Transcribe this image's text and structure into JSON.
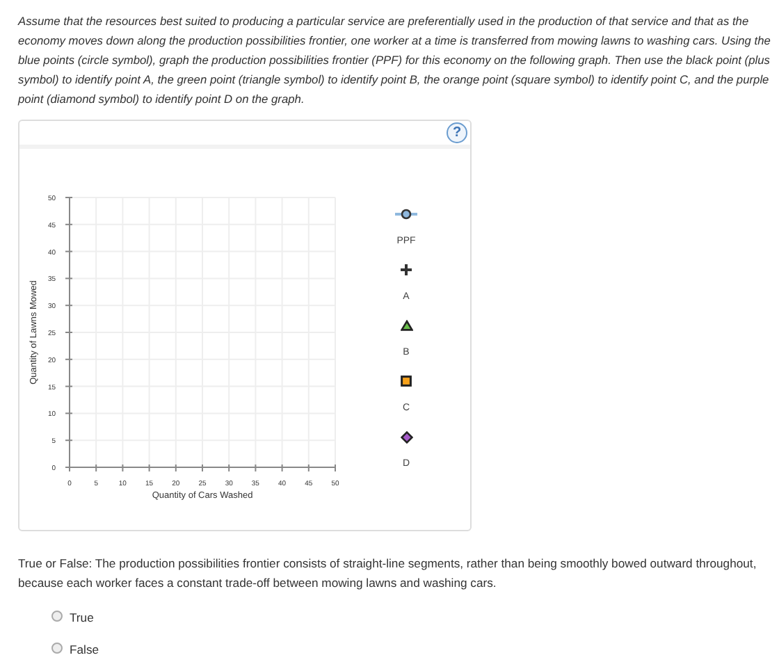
{
  "instructions": "Assume that the resources best suited to producing a particular service are preferentially used in the production of that service and that as the economy moves down along the production possibilities frontier, one worker at a time is transferred from mowing lawns to washing cars. Using the blue points (circle symbol), graph the production possibilities frontier (PPF) for this economy on the following graph. Then use the black point (plus symbol) to identify point A, the green point (triangle symbol) to identify point B, the orange point (square symbol) to identify point C, and the purple point (diamond symbol) to identify point D on the graph.",
  "help_button": "?",
  "graph": {
    "chart_data": {
      "type": "scatter",
      "grid": true,
      "xlabel": "Quantity of Cars Washed",
      "ylabel": "Quantity of Lawns Mowed",
      "xlim": [
        0,
        50
      ],
      "ylim": [
        0,
        50
      ],
      "xticks": [
        0,
        5,
        10,
        15,
        20,
        25,
        30,
        35,
        40,
        45,
        50
      ],
      "yticks": [
        0,
        5,
        10,
        15,
        20,
        25,
        30,
        35,
        40,
        45,
        50
      ]
    },
    "legend": [
      {
        "kind": "circle-line",
        "color": "#8fb8de",
        "label": "PPF"
      },
      {
        "kind": "plus",
        "color": "#333333",
        "label": "A"
      },
      {
        "kind": "triangle",
        "color": "#6abf4b",
        "label": "B"
      },
      {
        "kind": "square",
        "color": "#f7a21b",
        "label": "C"
      },
      {
        "kind": "diamond",
        "color": "#a55bc9",
        "label": "D"
      }
    ]
  },
  "question": {
    "text": "True or False: The production possibilities frontier consists of straight-line segments, rather than being smoothly bowed outward throughout, because each worker faces a constant trade-off between mowing lawns and washing cars.",
    "options": [
      {
        "label": "True",
        "selected": false
      },
      {
        "label": "False",
        "selected": false
      }
    ]
  }
}
